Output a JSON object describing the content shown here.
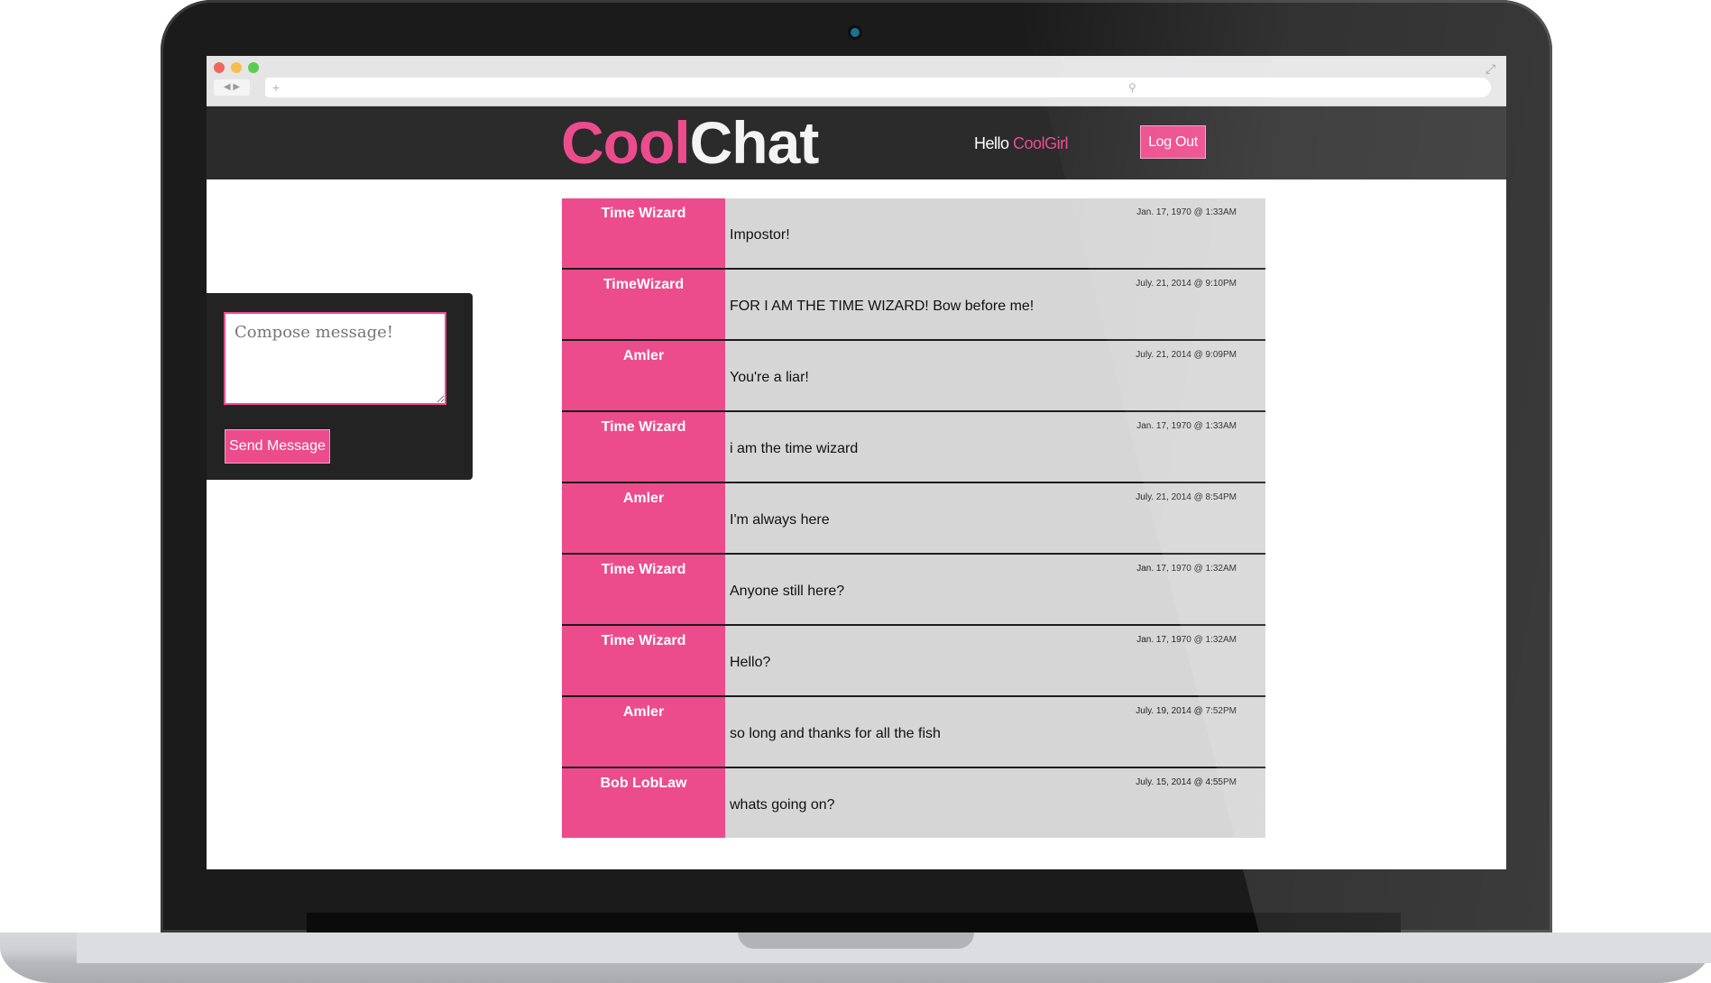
{
  "app": {
    "logo_part1": "Cool",
    "logo_part2": "Chat",
    "greeting": "Hello",
    "username": "CoolGirl",
    "logout_label": "Log Out"
  },
  "browser": {
    "new_tab": "+",
    "nav": "◀ ▶",
    "search_icon": "magnifier-icon",
    "expand_icon": "expand-icon"
  },
  "compose": {
    "placeholder": "Compose message!",
    "send_label": "Send Message"
  },
  "messages": [
    {
      "author": "Time Wizard",
      "time": "Jan. 17, 1970 @ 1:33AM",
      "text": "Impostor!"
    },
    {
      "author": "TimeWizard",
      "time": "July. 21, 2014 @ 9:10PM",
      "text": "FOR I AM THE TIME WIZARD! Bow before me!"
    },
    {
      "author": "Amler",
      "time": "July. 21, 2014 @ 9:09PM",
      "text": "You're a liar!"
    },
    {
      "author": "Time Wizard",
      "time": "Jan. 17, 1970 @ 1:33AM",
      "text": "i am the time wizard"
    },
    {
      "author": "Amler",
      "time": "July. 21, 2014 @ 8:54PM",
      "text": "I'm always here"
    },
    {
      "author": "Time Wizard",
      "time": "Jan. 17, 1970 @ 1:32AM",
      "text": "Anyone still here?"
    },
    {
      "author": "Time Wizard",
      "time": "Jan. 17, 1970 @ 1:32AM",
      "text": "Hello?"
    },
    {
      "author": "Amler",
      "time": "July. 19, 2014 @ 7:52PM",
      "text": "so long and thanks for all the fish"
    },
    {
      "author": "Bob LobLaw",
      "time": "July. 15, 2014 @ 4:55PM",
      "text": "whats going on?"
    }
  ],
  "colors": {
    "accent": "#ec4c8c",
    "header_bg": "#2b2b2c",
    "message_bg": "#d6d6d6"
  }
}
